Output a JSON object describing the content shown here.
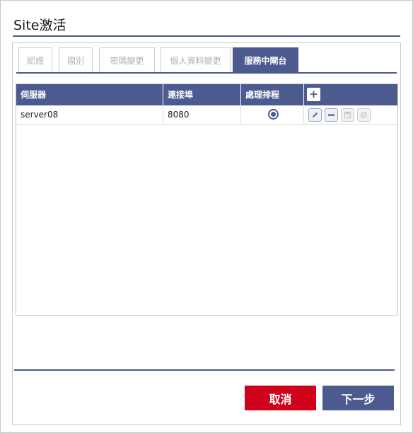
{
  "dialog": {
    "title": "Site激活"
  },
  "tabs": [
    {
      "label": "認證",
      "active": false
    },
    {
      "label": "國別",
      "active": false
    },
    {
      "label": "密碼變更",
      "active": false
    },
    {
      "label": "個人資料變更",
      "active": false
    },
    {
      "label": "服務中閘台",
      "active": true
    }
  ],
  "table": {
    "headers": {
      "server": "伺服器",
      "port": "連接埠",
      "schedule": "處理排程"
    },
    "add_icon": "plus-icon",
    "rows": [
      {
        "server": "server08",
        "port": "8080",
        "schedule_selected": true,
        "actions": {
          "edit_icon": "pencil-icon",
          "remove_icon": "minus-icon",
          "save_icon": "save-icon",
          "cancel_icon": "ban-icon"
        }
      }
    ]
  },
  "footer": {
    "cancel_label": "取消",
    "next_label": "下一步"
  },
  "colors": {
    "accent": "#4b5a8f",
    "danger": "#d0021b"
  }
}
